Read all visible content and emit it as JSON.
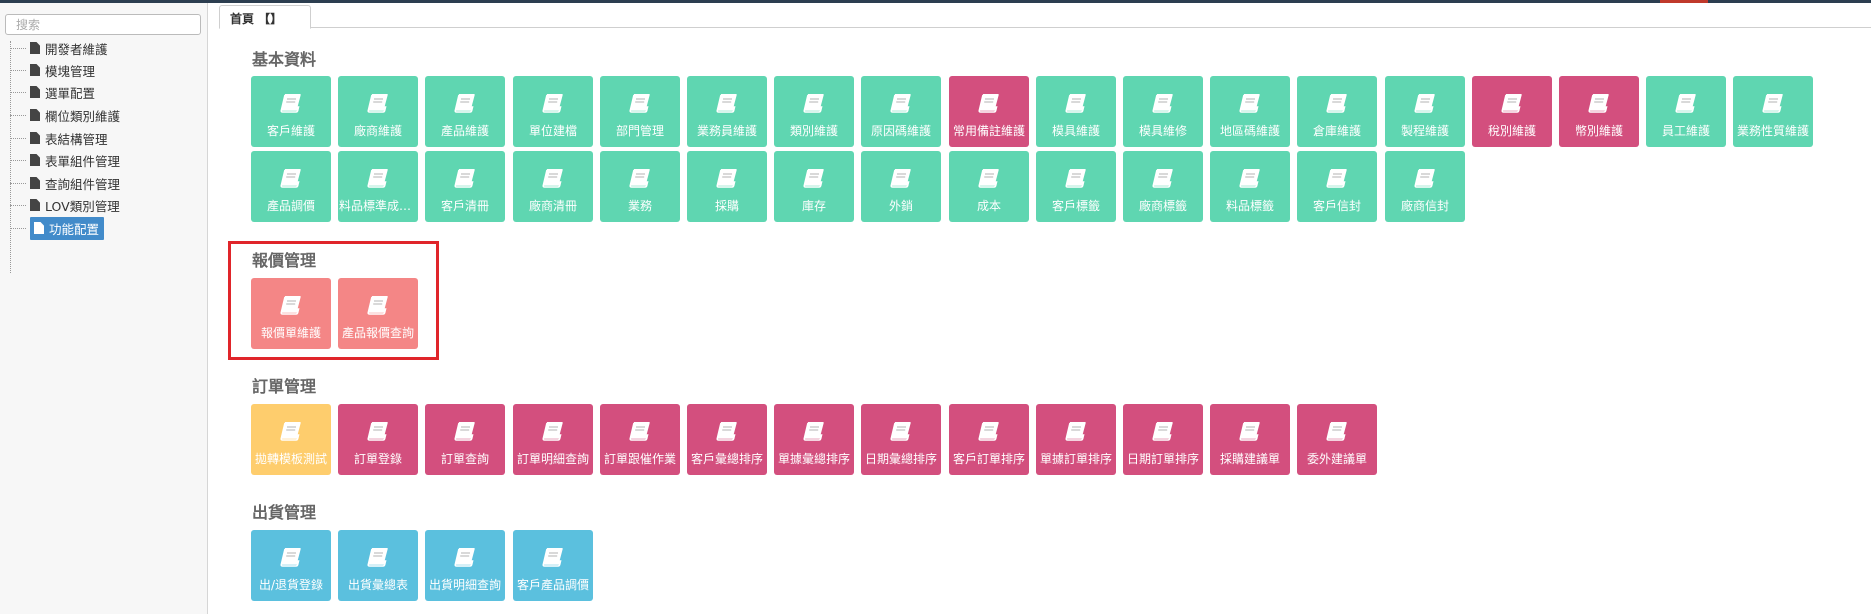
{
  "colors": {
    "green": "#5fd6b1",
    "pink": "#d34f7e",
    "salmon": "#f48686",
    "yellow": "#fecd6d",
    "blue": "#5bc0de",
    "highlight": "#e0252a",
    "selected": "#428bca"
  },
  "sidebar": {
    "search_placeholder": "搜索",
    "items": [
      {
        "label": "開發者維護",
        "icon": "file-icon"
      },
      {
        "label": "模塊管理",
        "icon": "file-icon"
      },
      {
        "label": "選單配置",
        "icon": "file-icon"
      },
      {
        "label": "欄位類別維護",
        "icon": "file-icon"
      },
      {
        "label": "表結構管理",
        "icon": "file-icon"
      },
      {
        "label": "表單組件管理",
        "icon": "file-icon"
      },
      {
        "label": "查詢組件管理",
        "icon": "file-icon"
      },
      {
        "label": "LOV類別管理",
        "icon": "file-icon"
      },
      {
        "label": "功能配置",
        "icon": "file-icon",
        "selected": true
      }
    ]
  },
  "tabs": [
    {
      "label": "首頁 【】",
      "active": true
    }
  ],
  "sections": [
    {
      "title": "基本資料",
      "tiles": [
        {
          "label": "客戶維護",
          "color": "green"
        },
        {
          "label": "廠商維護",
          "color": "green"
        },
        {
          "label": "產品維護",
          "color": "green"
        },
        {
          "label": "單位建檔",
          "color": "green"
        },
        {
          "label": "部門管理",
          "color": "green"
        },
        {
          "label": "業務員維護",
          "color": "green"
        },
        {
          "label": "類別維護",
          "color": "green"
        },
        {
          "label": "原因碼維護",
          "color": "green"
        },
        {
          "label": "常用備註維護",
          "color": "pink"
        },
        {
          "label": "模具維護",
          "color": "green"
        },
        {
          "label": "模具維修",
          "color": "green"
        },
        {
          "label": "地區碼維護",
          "color": "green"
        },
        {
          "label": "倉庫維護",
          "color": "green"
        },
        {
          "label": "製程維護",
          "color": "green"
        },
        {
          "label": "稅別維護",
          "color": "pink"
        },
        {
          "label": "幣別維護",
          "color": "pink"
        },
        {
          "label": "員工維護",
          "color": "green"
        },
        {
          "label": "業務性質維護",
          "color": "green"
        },
        {
          "label": "產品調價",
          "color": "green"
        },
        {
          "label": "料品標準成本維護",
          "color": "green"
        },
        {
          "label": "客戶清冊",
          "color": "green"
        },
        {
          "label": "廠商清冊",
          "color": "green"
        },
        {
          "label": "業務",
          "color": "green"
        },
        {
          "label": "採購",
          "color": "green"
        },
        {
          "label": "庫存",
          "color": "green"
        },
        {
          "label": "外銷",
          "color": "green"
        },
        {
          "label": "成本",
          "color": "green"
        },
        {
          "label": "客戶標籤",
          "color": "green"
        },
        {
          "label": "廠商標籤",
          "color": "green"
        },
        {
          "label": "料品標籤",
          "color": "green"
        },
        {
          "label": "客戶信封",
          "color": "green"
        },
        {
          "label": "廠商信封",
          "color": "green"
        }
      ]
    },
    {
      "title": "報價管理",
      "tiles": [
        {
          "label": "報價單維護",
          "color": "salmon"
        },
        {
          "label": "產品報價查詢",
          "color": "salmon"
        }
      ]
    },
    {
      "title": "訂單管理",
      "tiles": [
        {
          "label": "拋轉模板測試",
          "color": "yellow"
        },
        {
          "label": "訂單登錄",
          "color": "pink"
        },
        {
          "label": "訂單查詢",
          "color": "pink"
        },
        {
          "label": "訂單明細查詢",
          "color": "pink"
        },
        {
          "label": "訂單跟催作業",
          "color": "pink"
        },
        {
          "label": "客戶彙總排序",
          "color": "pink"
        },
        {
          "label": "單據彙總排序",
          "color": "pink"
        },
        {
          "label": "日期彙總排序",
          "color": "pink"
        },
        {
          "label": "客戶訂單排序",
          "color": "pink"
        },
        {
          "label": "單據訂單排序",
          "color": "pink"
        },
        {
          "label": "日期訂單排序",
          "color": "pink"
        },
        {
          "label": "採購建議單",
          "color": "pink"
        },
        {
          "label": "委外建議單",
          "color": "pink"
        }
      ]
    },
    {
      "title": "出貨管理",
      "tiles": [
        {
          "label": "出/退貨登錄",
          "color": "blue"
        },
        {
          "label": "出貨彙總表",
          "color": "blue"
        },
        {
          "label": "出貨明細查詢",
          "color": "blue"
        },
        {
          "label": "客戶產品調價",
          "color": "blue"
        }
      ]
    }
  ]
}
